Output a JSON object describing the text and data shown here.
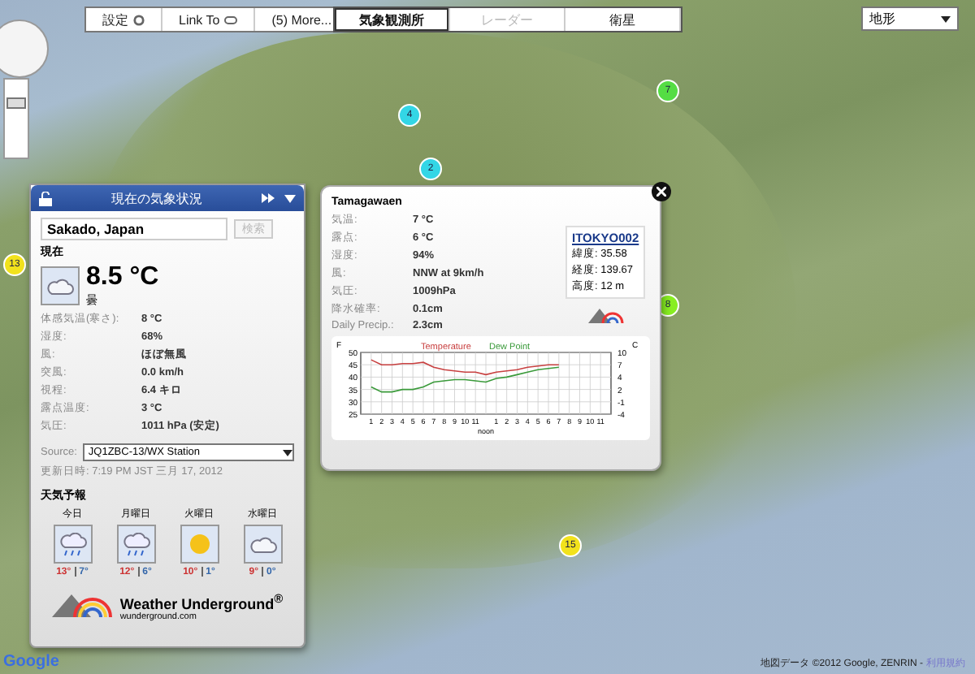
{
  "zoom": {
    "level": 0.75
  },
  "toolbar": {
    "items": [
      {
        "label": "設定"
      },
      {
        "label": "Link To"
      },
      {
        "label": "(5) More..."
      }
    ]
  },
  "layer_tabs": [
    {
      "label": "気象観測所",
      "selected": true,
      "disabled": false
    },
    {
      "label": "レーダー",
      "selected": false,
      "disabled": true
    },
    {
      "label": "衛星",
      "selected": false,
      "disabled": false
    }
  ],
  "map_type": "地形",
  "markers": [
    {
      "label": "4",
      "color": "#33d6e6"
    },
    {
      "label": "2",
      "color": "#33d6e6"
    },
    {
      "label": "7",
      "color": "#55dd44"
    },
    {
      "label": "8",
      "color": "#88ee22"
    },
    {
      "label": "13",
      "color": "#f2e21c"
    },
    {
      "label": "15",
      "color": "#f2e21c"
    }
  ],
  "current": {
    "title": "現在の気象状況",
    "location": "Sakado, Japan",
    "search_button": "検索",
    "now_label": "現在",
    "temperature": "8.5 °C",
    "condition": "曇",
    "details": [
      {
        "label": "体感気温(寒さ):",
        "value": "8 °C"
      },
      {
        "label": "湿度:",
        "value": "68%"
      },
      {
        "label": "風:",
        "value": "ほぼ無風"
      },
      {
        "label": "突風:",
        "value": "0.0 km/h"
      },
      {
        "label": "視程:",
        "value": "6.4 キロ"
      },
      {
        "label": "露点温度:",
        "value": "3 °C"
      },
      {
        "label": "気圧:",
        "value": "1011 hPa (安定)"
      }
    ],
    "source_label": "Source:",
    "source": "JQ1ZBC-13/WX Station",
    "updated": "更新日時: 7:19 PM JST 三月 17, 2012",
    "forecast_title": "天気予報",
    "forecast": [
      {
        "day": "今日",
        "kind": "rain",
        "high": "13°",
        "low": "7°"
      },
      {
        "day": "月曜日",
        "kind": "rain",
        "high": "12°",
        "low": "6°"
      },
      {
        "day": "火曜日",
        "kind": "sun",
        "high": "10°",
        "low": "1°"
      },
      {
        "day": "水曜日",
        "kind": "cloud",
        "high": "9°",
        "low": "0°"
      }
    ],
    "brand": "Weather Underground$^{®}$",
    "brand_url": "wunderground.com"
  },
  "station": {
    "name": "Tamagawaen",
    "details": [
      {
        "label": "気温:",
        "value": "7 °C"
      },
      {
        "label": "露点:",
        "value": "6 °C"
      },
      {
        "label": "湿度:",
        "value": "94%"
      },
      {
        "label": "風:",
        "value": "NNW at 9km/h"
      },
      {
        "label": "気圧:",
        "value": "1009hPa"
      },
      {
        "label": "降水確率:",
        "value": "0.1cm"
      },
      {
        "label": "Daily Precip.:",
        "value": "2.3cm"
      }
    ],
    "station_id": "ITOKYO002",
    "coords": [
      "緯度: 35.58",
      "経度: 139.67",
      "高度: 12 m"
    ],
    "chart_data": {
      "type": "line",
      "ylabel": "F",
      "y2label": "C",
      "grid": true,
      "categories": [
        "1",
        "2",
        "3",
        "4",
        "5",
        "6",
        "7",
        "8",
        "9",
        "10",
        "11",
        "noon",
        "1",
        "2",
        "3",
        "4",
        "5",
        "6",
        "7",
        "8",
        "9",
        "10",
        "11"
      ],
      "series": [
        {
          "name": "Temperature",
          "color": "#c84040",
          "values": [
            47,
            45,
            45,
            45.5,
            45.5,
            46,
            44,
            43,
            42.5,
            42,
            42,
            41,
            42,
            42.5,
            43,
            44,
            44.5,
            45,
            45,
            null,
            null,
            null,
            null
          ]
        },
        {
          "name": "Dew Point",
          "color": "#3a9a3a",
          "values": [
            36,
            34,
            34,
            35,
            35,
            36,
            38,
            38.5,
            39,
            39,
            38.5,
            38,
            39.5,
            40,
            41,
            42,
            43,
            43.5,
            44,
            null,
            null,
            null,
            null
          ]
        }
      ],
      "ylim": [
        25,
        50
      ],
      "yticks": [
        25,
        30,
        35,
        40,
        45,
        50
      ],
      "y2ticks": [
        "-4",
        "-1",
        "2",
        "4",
        "7",
        "10"
      ]
    }
  },
  "attribution": {
    "text": "地図データ ©2012 Google, ZENRIN -",
    "link": "利用規約"
  },
  "map_logo": "Google"
}
